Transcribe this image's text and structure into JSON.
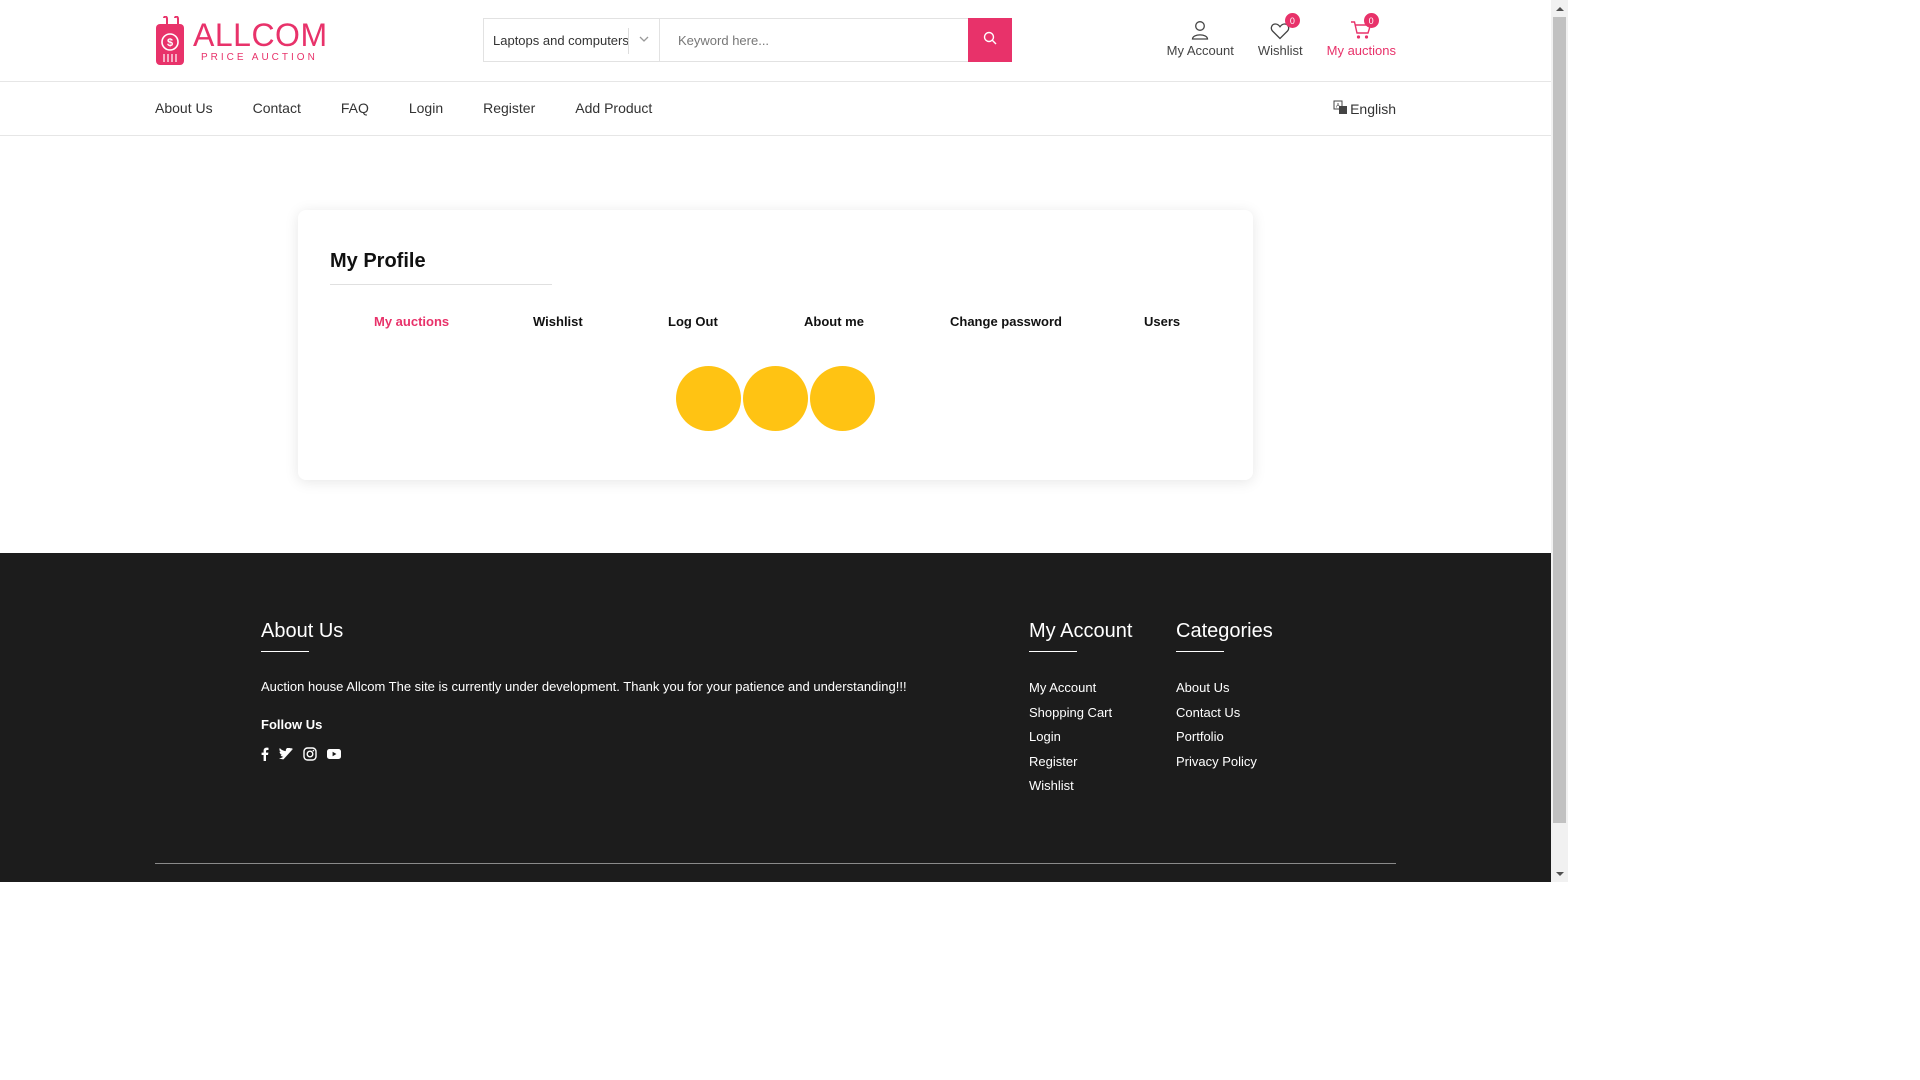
{
  "brand": {
    "name": "ALLCOM",
    "tagline": "PRICE AUCTION",
    "color": "#e8326a"
  },
  "search": {
    "category": "Laptops and computers",
    "placeholder": "Keyword here...",
    "icon": "search-icon"
  },
  "header_icons": {
    "account": {
      "label": "My Account",
      "icon": "user-icon"
    },
    "wishlist": {
      "label": "Wishlist",
      "count": "0",
      "icon": "heart-icon"
    },
    "auctions": {
      "label": "My auctions",
      "count": "0",
      "icon": "cart-icon"
    }
  },
  "nav": {
    "links": [
      "About Us",
      "Contact",
      "FAQ",
      "Login",
      "Register",
      "Add Product"
    ],
    "language": "English"
  },
  "profile": {
    "title": "My Profile",
    "tabs": [
      "My auctions",
      "Wishlist",
      "Log Out",
      "About me",
      "Change password",
      "Users"
    ],
    "active_tab": "My auctions",
    "loader_color": "#ffc313"
  },
  "footer": {
    "about": {
      "title": "About Us",
      "text": "Auction house Allcom The site is currently under development. Thank you for your patience and understanding!!!",
      "follow_title": "Follow Us",
      "social_icons": [
        "facebook-icon",
        "twitter-icon",
        "instagram-icon",
        "youtube-icon"
      ]
    },
    "my_account": {
      "title": "My Account",
      "links": [
        "My Account",
        "Shopping Cart",
        "Login",
        "Register",
        "Wishlist"
      ]
    },
    "categories": {
      "title": "Categories",
      "links": [
        "About Us",
        "Contact Us",
        "Portfolio",
        "Privacy Policy"
      ]
    }
  }
}
